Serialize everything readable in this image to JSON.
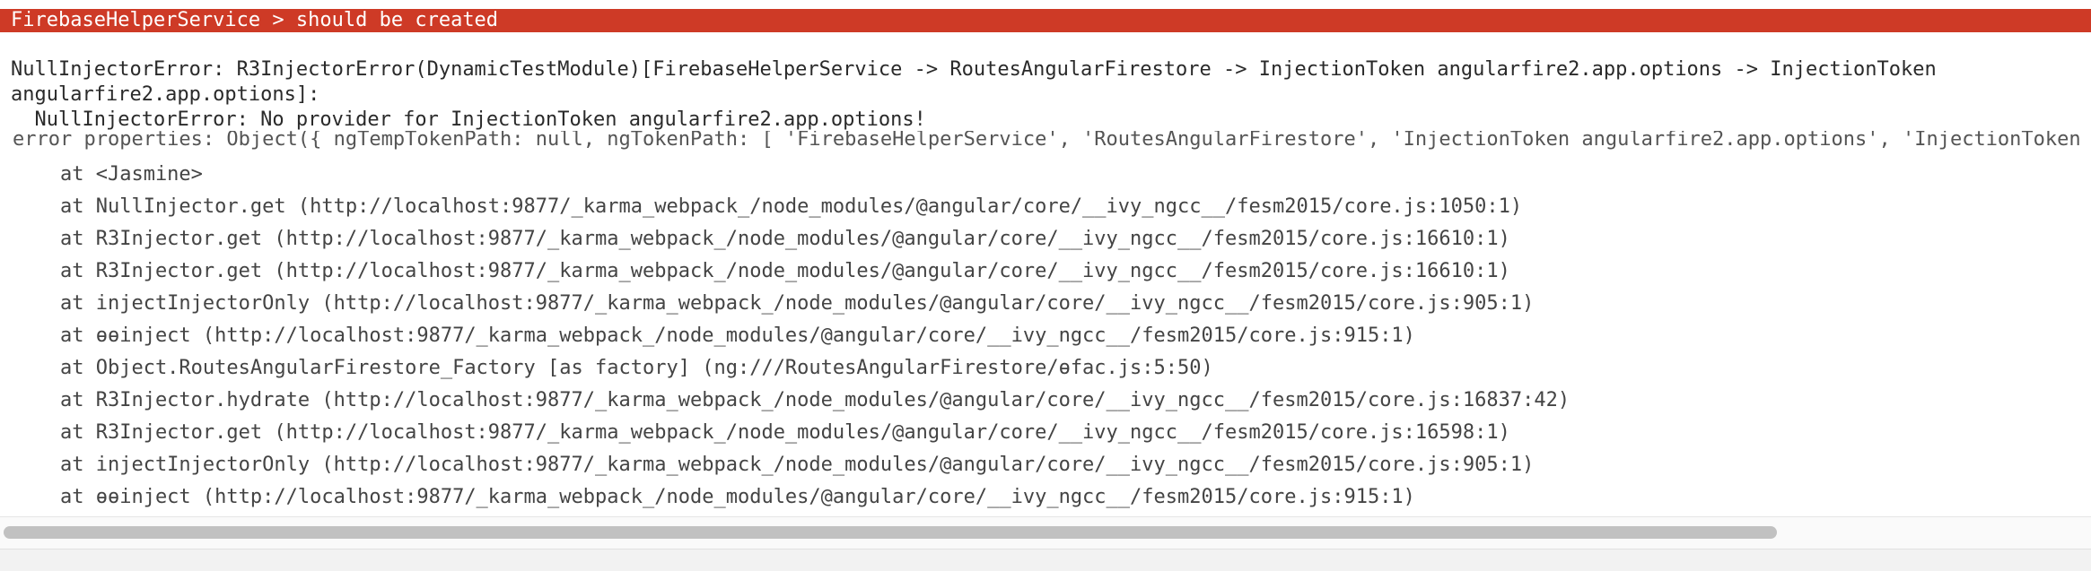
{
  "spec": {
    "title": "FirebaseHelperService > should be created"
  },
  "error": {
    "message": "NullInjectorError: R3InjectorError(DynamicTestModule)[FirebaseHelperService -> RoutesAngularFirestore -> InjectionToken angularfire2.app.options -> InjectionToken angularfire2.app.options]:\n  NullInjectorError: No provider for InjectionToken angularfire2.app.options!"
  },
  "stack": {
    "properties_line": "error properties: Object({ ngTempTokenPath: null, ngTokenPath: [ 'FirebaseHelperService', 'RoutesAngularFirestore', 'InjectionToken angularfire2.app.options', 'InjectionToken a",
    "lines": [
      "    at <Jasmine>",
      "    at NullInjector.get (http://localhost:9877/_karma_webpack_/node_modules/@angular/core/__ivy_ngcc__/fesm2015/core.js:1050:1)",
      "    at R3Injector.get (http://localhost:9877/_karma_webpack_/node_modules/@angular/core/__ivy_ngcc__/fesm2015/core.js:16610:1)",
      "    at R3Injector.get (http://localhost:9877/_karma_webpack_/node_modules/@angular/core/__ivy_ngcc__/fesm2015/core.js:16610:1)",
      "    at injectInjectorOnly (http://localhost:9877/_karma_webpack_/node_modules/@angular/core/__ivy_ngcc__/fesm2015/core.js:905:1)",
      "    at ɵɵinject (http://localhost:9877/_karma_webpack_/node_modules/@angular/core/__ivy_ngcc__/fesm2015/core.js:915:1)",
      "    at Object.RoutesAngularFirestore_Factory [as factory] (ng:///RoutesAngularFirestore/ɵfac.js:5:50)",
      "    at R3Injector.hydrate (http://localhost:9877/_karma_webpack_/node_modules/@angular/core/__ivy_ngcc__/fesm2015/core.js:16837:42)",
      "    at R3Injector.get (http://localhost:9877/_karma_webpack_/node_modules/@angular/core/__ivy_ngcc__/fesm2015/core.js:16598:1)",
      "    at injectInjectorOnly (http://localhost:9877/_karma_webpack_/node_modules/@angular/core/__ivy_ngcc__/fesm2015/core.js:905:1)",
      "    at ɵɵinject (http://localhost:9877/_karma_webpack_/node_modules/@angular/core/__ivy_ngcc__/fesm2015/core.js:915:1)"
    ]
  },
  "colors": {
    "failure_red": "#ce3a26",
    "text": "#222222",
    "scrollbar_thumb": "#c1c1c1"
  }
}
